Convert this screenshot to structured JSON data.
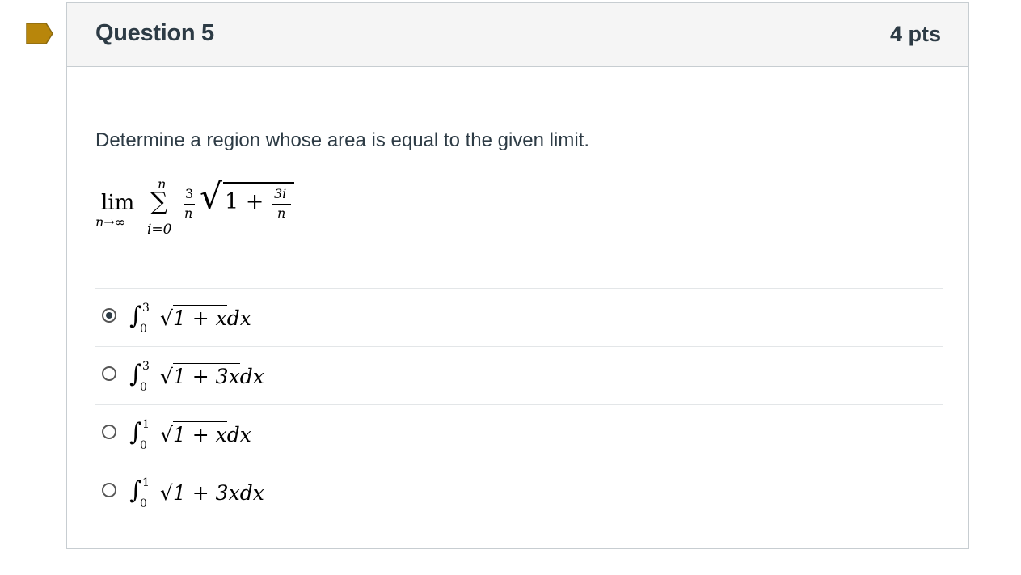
{
  "question": {
    "title": "Question 5",
    "points": "4 pts",
    "prompt": "Determine a region whose area is equal to the given limit.",
    "flag_color": "#b8860b"
  },
  "limit_formula": {
    "lim": "lim",
    "sub": "n→∞",
    "sigma": "∑",
    "sigma_top": "n",
    "sigma_bottom": "i=0",
    "frac_num": "3",
    "frac_den": "n",
    "radical": "√",
    "inner": "1 +",
    "inner_num": "3i",
    "inner_den": "n"
  },
  "answers": [
    {
      "upper": "3",
      "lower": "0",
      "radicand": "1 + x",
      "tail": "dx",
      "selected": true
    },
    {
      "upper": "3",
      "lower": "0",
      "radicand": "1 + 3x",
      "tail": "dx",
      "selected": false
    },
    {
      "upper": "1",
      "lower": "0",
      "radicand": "1 + x",
      "tail": "dx",
      "selected": false
    },
    {
      "upper": "1",
      "lower": "0",
      "radicand": "1 + 3x",
      "tail": "dx",
      "selected": false
    }
  ],
  "symbols": {
    "integral": "∫",
    "radical": "√"
  }
}
